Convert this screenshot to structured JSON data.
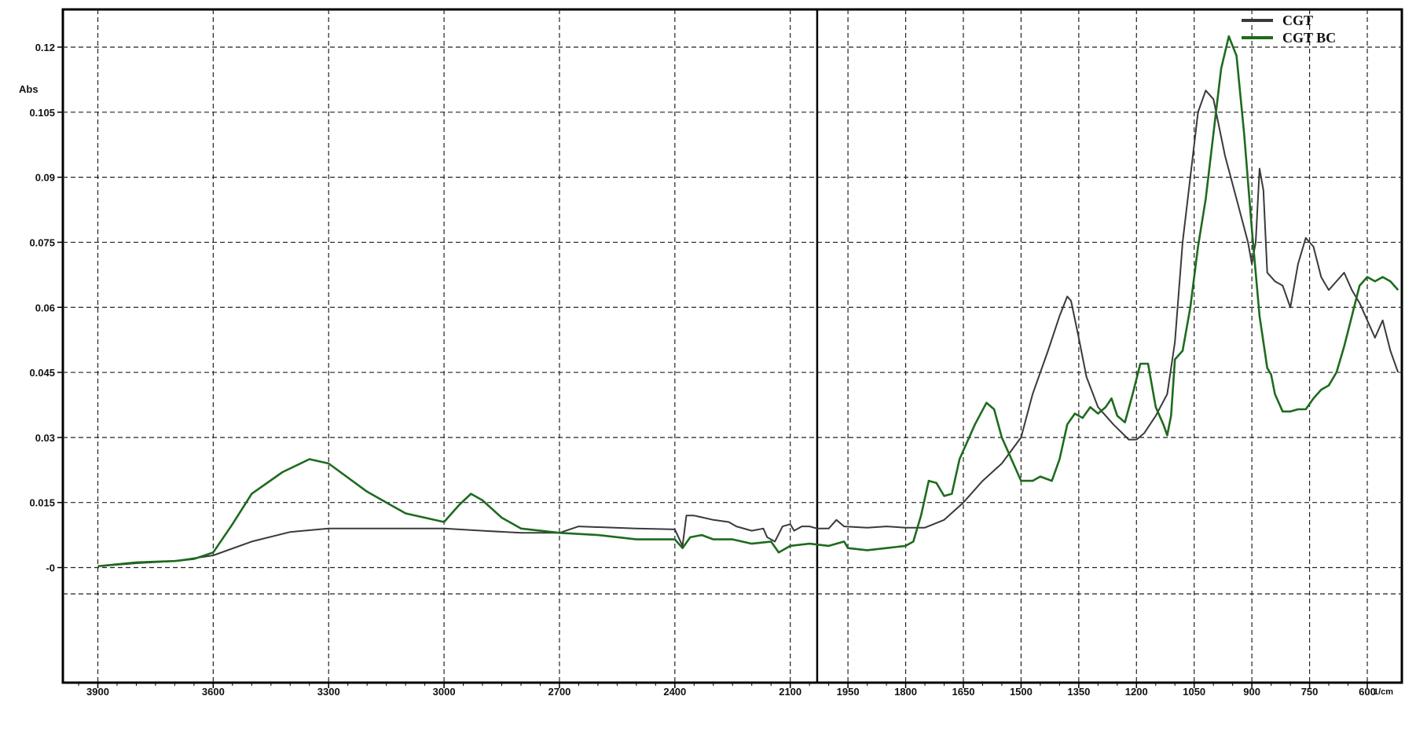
{
  "chart_data": {
    "type": "line",
    "title": "",
    "xlabel": "1/cm",
    "ylabel": "Abs",
    "xlim": [
      4000,
      600
    ],
    "ylim": [
      -0.006,
      0.129
    ],
    "x_reversed": true,
    "grid": true,
    "legend_position": "top-right",
    "x_ticks": [
      3900,
      3600,
      3300,
      3000,
      2700,
      2400,
      2100,
      1950,
      1800,
      1650,
      1500,
      1350,
      1200,
      1050,
      900,
      750,
      600
    ],
    "x_tick_labels": [
      "3900",
      "3600",
      "3300",
      "3000",
      "2700",
      "2400",
      "2100",
      "1950",
      "1800",
      "1650",
      "1500",
      "1350",
      "1200",
      "1050",
      "900",
      "750",
      "600"
    ],
    "y_ticks": [
      0,
      0.015,
      0.03,
      0.045,
      0.06,
      0.075,
      0.09,
      0.105,
      0.12
    ],
    "y_tick_labels": [
      "-0",
      "0.015",
      "0.03",
      "0.045",
      "0.06",
      "0.075",
      "0.09",
      "0.105",
      "0.12"
    ],
    "cursor_x": 2030,
    "series": [
      {
        "name": "CGT",
        "color": "#3a3a3a",
        "points": [
          [
            4000,
            0.0003
          ],
          [
            3900,
            0.0003
          ],
          [
            3800,
            0.001
          ],
          [
            3700,
            0.0015
          ],
          [
            3600,
            0.0028
          ],
          [
            3500,
            0.006
          ],
          [
            3400,
            0.0082
          ],
          [
            3300,
            0.009
          ],
          [
            3200,
            0.009
          ],
          [
            3000,
            0.009
          ],
          [
            2900,
            0.0085
          ],
          [
            2800,
            0.008
          ],
          [
            2700,
            0.008
          ],
          [
            2650,
            0.0095
          ],
          [
            2500,
            0.009
          ],
          [
            2400,
            0.0088
          ],
          [
            2380,
            0.005
          ],
          [
            2370,
            0.012
          ],
          [
            2350,
            0.012
          ],
          [
            2300,
            0.011
          ],
          [
            2260,
            0.0105
          ],
          [
            2240,
            0.0095
          ],
          [
            2200,
            0.0085
          ],
          [
            2170,
            0.009
          ],
          [
            2160,
            0.007
          ],
          [
            2140,
            0.006
          ],
          [
            2120,
            0.0095
          ],
          [
            2100,
            0.01
          ],
          [
            2090,
            0.0085
          ],
          [
            2070,
            0.0095
          ],
          [
            2050,
            0.0095
          ],
          [
            2030,
            0.009
          ],
          [
            2000,
            0.009
          ],
          [
            1980,
            0.011
          ],
          [
            1960,
            0.0095
          ],
          [
            1900,
            0.0092
          ],
          [
            1850,
            0.0095
          ],
          [
            1800,
            0.0092
          ],
          [
            1750,
            0.0092
          ],
          [
            1700,
            0.011
          ],
          [
            1650,
            0.015
          ],
          [
            1600,
            0.02
          ],
          [
            1550,
            0.024
          ],
          [
            1500,
            0.03
          ],
          [
            1470,
            0.04
          ],
          [
            1430,
            0.05
          ],
          [
            1400,
            0.058
          ],
          [
            1380,
            0.0625
          ],
          [
            1370,
            0.0615
          ],
          [
            1350,
            0.053
          ],
          [
            1330,
            0.044
          ],
          [
            1300,
            0.037
          ],
          [
            1260,
            0.033
          ],
          [
            1220,
            0.0295
          ],
          [
            1200,
            0.0295
          ],
          [
            1180,
            0.031
          ],
          [
            1150,
            0.035
          ],
          [
            1120,
            0.04
          ],
          [
            1100,
            0.052
          ],
          [
            1080,
            0.075
          ],
          [
            1060,
            0.09
          ],
          [
            1040,
            0.105
          ],
          [
            1020,
            0.11
          ],
          [
            1000,
            0.108
          ],
          [
            970,
            0.095
          ],
          [
            940,
            0.085
          ],
          [
            910,
            0.075
          ],
          [
            900,
            0.07
          ],
          [
            890,
            0.075
          ],
          [
            880,
            0.092
          ],
          [
            870,
            0.087
          ],
          [
            860,
            0.068
          ],
          [
            840,
            0.066
          ],
          [
            820,
            0.065
          ],
          [
            800,
            0.06
          ],
          [
            780,
            0.07
          ],
          [
            760,
            0.076
          ],
          [
            740,
            0.074
          ],
          [
            720,
            0.067
          ],
          [
            700,
            0.064
          ],
          [
            680,
            0.066
          ],
          [
            660,
            0.068
          ],
          [
            640,
            0.064
          ],
          [
            620,
            0.061
          ],
          [
            600,
            0.057
          ],
          [
            580,
            0.053
          ],
          [
            560,
            0.057
          ],
          [
            540,
            0.05
          ],
          [
            520,
            0.045
          ]
        ]
      },
      {
        "name": "CGT BC",
        "color": "#1e6b1e",
        "points": [
          [
            4000,
            0.0005
          ],
          [
            3900,
            0.0003
          ],
          [
            3800,
            0.0012
          ],
          [
            3700,
            0.0015
          ],
          [
            3650,
            0.002
          ],
          [
            3600,
            0.0035
          ],
          [
            3550,
            0.01
          ],
          [
            3500,
            0.017
          ],
          [
            3420,
            0.022
          ],
          [
            3350,
            0.025
          ],
          [
            3300,
            0.024
          ],
          [
            3200,
            0.0175
          ],
          [
            3100,
            0.0125
          ],
          [
            3000,
            0.0105
          ],
          [
            2960,
            0.0145
          ],
          [
            2930,
            0.017
          ],
          [
            2900,
            0.0155
          ],
          [
            2850,
            0.0115
          ],
          [
            2800,
            0.009
          ],
          [
            2700,
            0.008
          ],
          [
            2600,
            0.0075
          ],
          [
            2500,
            0.0065
          ],
          [
            2400,
            0.0065
          ],
          [
            2380,
            0.0045
          ],
          [
            2360,
            0.007
          ],
          [
            2330,
            0.0075
          ],
          [
            2300,
            0.0065
          ],
          [
            2250,
            0.0065
          ],
          [
            2200,
            0.0055
          ],
          [
            2150,
            0.006
          ],
          [
            2130,
            0.0035
          ],
          [
            2100,
            0.005
          ],
          [
            2050,
            0.0055
          ],
          [
            2000,
            0.005
          ],
          [
            1980,
            0.0055
          ],
          [
            1960,
            0.006
          ],
          [
            1950,
            0.0045
          ],
          [
            1900,
            0.004
          ],
          [
            1850,
            0.0045
          ],
          [
            1800,
            0.005
          ],
          [
            1780,
            0.006
          ],
          [
            1760,
            0.012
          ],
          [
            1740,
            0.02
          ],
          [
            1720,
            0.0195
          ],
          [
            1700,
            0.0165
          ],
          [
            1680,
            0.017
          ],
          [
            1660,
            0.025
          ],
          [
            1620,
            0.033
          ],
          [
            1590,
            0.038
          ],
          [
            1570,
            0.0365
          ],
          [
            1550,
            0.03
          ],
          [
            1520,
            0.024
          ],
          [
            1500,
            0.02
          ],
          [
            1470,
            0.02
          ],
          [
            1450,
            0.021
          ],
          [
            1420,
            0.02
          ],
          [
            1400,
            0.025
          ],
          [
            1380,
            0.033
          ],
          [
            1360,
            0.0355
          ],
          [
            1340,
            0.0345
          ],
          [
            1320,
            0.037
          ],
          [
            1300,
            0.0355
          ],
          [
            1280,
            0.037
          ],
          [
            1265,
            0.039
          ],
          [
            1250,
            0.035
          ],
          [
            1230,
            0.0335
          ],
          [
            1210,
            0.04
          ],
          [
            1190,
            0.047
          ],
          [
            1170,
            0.047
          ],
          [
            1150,
            0.037
          ],
          [
            1130,
            0.033
          ],
          [
            1120,
            0.0305
          ],
          [
            1110,
            0.035
          ],
          [
            1100,
            0.048
          ],
          [
            1080,
            0.05
          ],
          [
            1060,
            0.06
          ],
          [
            1040,
            0.074
          ],
          [
            1020,
            0.085
          ],
          [
            1000,
            0.1
          ],
          [
            980,
            0.115
          ],
          [
            960,
            0.1225
          ],
          [
            940,
            0.118
          ],
          [
            920,
            0.1
          ],
          [
            900,
            0.078
          ],
          [
            880,
            0.058
          ],
          [
            860,
            0.046
          ],
          [
            850,
            0.0445
          ],
          [
            840,
            0.04
          ],
          [
            820,
            0.036
          ],
          [
            800,
            0.036
          ],
          [
            780,
            0.0365
          ],
          [
            760,
            0.0365
          ],
          [
            740,
            0.039
          ],
          [
            720,
            0.041
          ],
          [
            700,
            0.042
          ],
          [
            680,
            0.045
          ],
          [
            660,
            0.051
          ],
          [
            640,
            0.058
          ],
          [
            620,
            0.065
          ],
          [
            600,
            0.067
          ],
          [
            580,
            0.066
          ],
          [
            560,
            0.067
          ],
          [
            540,
            0.066
          ],
          [
            520,
            0.064
          ]
        ]
      }
    ]
  }
}
